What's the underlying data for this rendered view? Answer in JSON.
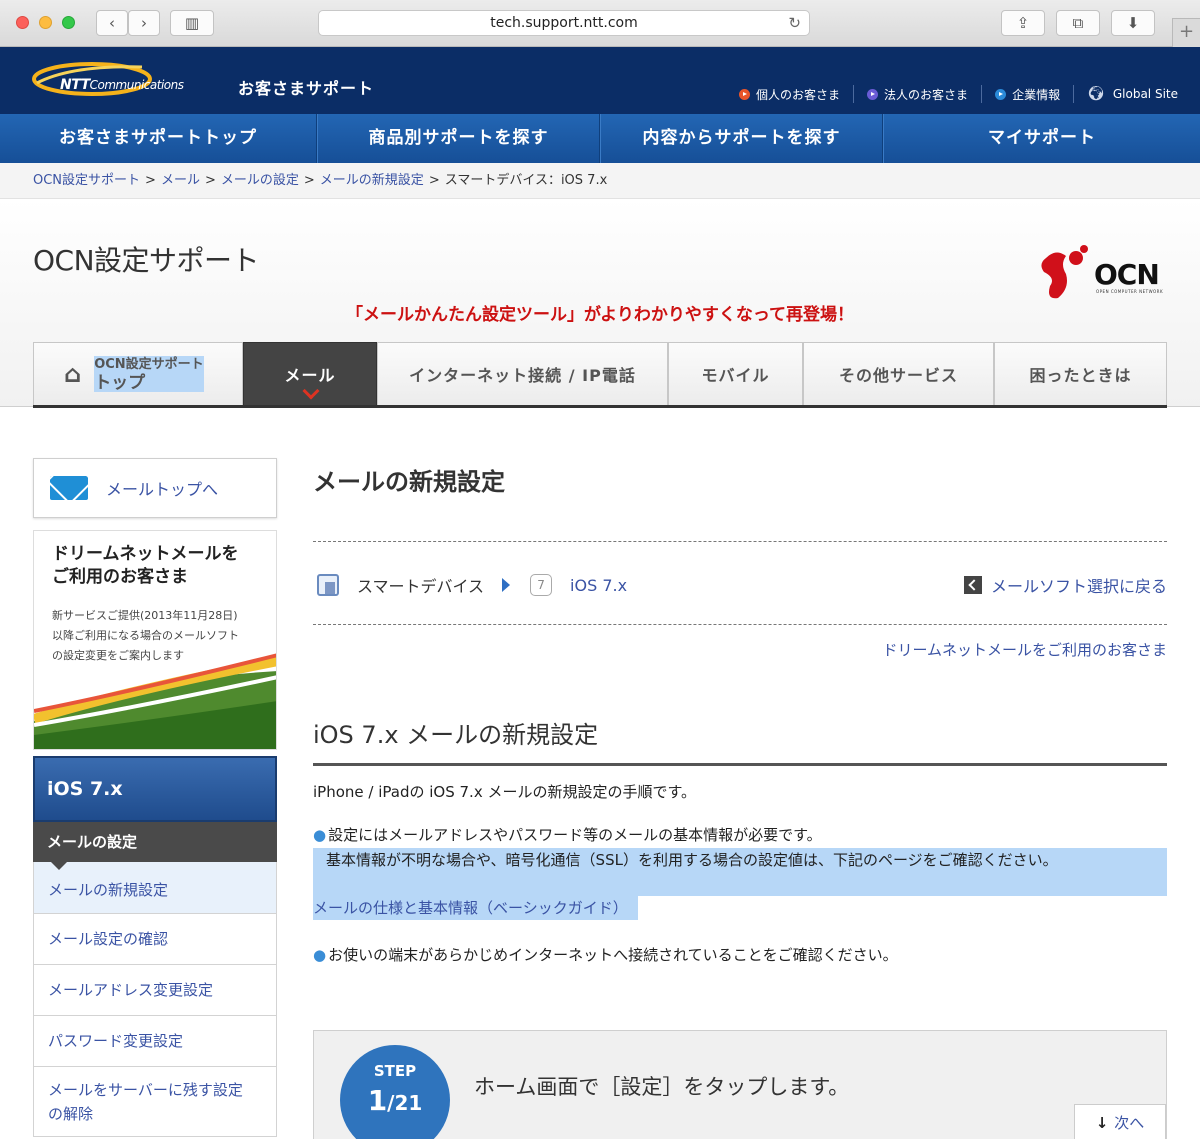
{
  "browser": {
    "url": "tech.support.ntt.com",
    "back_icon": "chevron-left-icon",
    "forward_icon": "chevron-right-icon"
  },
  "header": {
    "logo_brand": "NTT",
    "logo_sub": "Communications",
    "title": "お客さまサポート",
    "toplinks": [
      "個人のお客さま",
      "法人のお客さま",
      "企業情報",
      "Global Site"
    ]
  },
  "gnav": [
    "お客さまサポートトップ",
    "商品別サポートを探す",
    "内容からサポートを探す",
    "マイサポート"
  ],
  "breadcrumb": {
    "items": [
      "OCN設定サポート",
      "メール",
      "メールの設定",
      "メールの新規設定"
    ],
    "current": "スマートデバイス：iOS 7.x",
    "sep": ">"
  },
  "site_title": "OCN設定サポート",
  "ocn_logo": {
    "word": "OCN",
    "sub": "OPEN COMPUTER NETWORK"
  },
  "promo": "「メールかんたん設定ツール」がよりわかりやすくなって再登場！",
  "category_tabs": {
    "home_small": "OCN設定サポート",
    "home_big": "トップ",
    "tabs": [
      "メール",
      "インターネット接続 / IP電話",
      "モバイル",
      "その他サービス",
      "困ったときは"
    ]
  },
  "sidebar": {
    "mail_top": "メールトップへ",
    "banner_title_1": "ドリームネットメールを",
    "banner_title_2": "ご利用のお客さま",
    "banner_sub_1": "新サービスご提供(2013年11月28日)",
    "banner_sub_2": "以降ご利用になる場合のメールソフト",
    "banner_sub_3": "の設定変更をご案内します",
    "ios_heading": "iOS 7.x",
    "settings_heading": "メールの設定",
    "items": [
      "メールの新規設定",
      "メール設定の確認",
      "メールアドレス変更設定",
      "パスワード変更設定"
    ],
    "last_item_1": "メールをサーバーに残す設定",
    "last_item_2": "の解除"
  },
  "main": {
    "heading": "メールの新規設定",
    "device_label": "スマートデバイス",
    "os_label": "iOS 7.x",
    "back_link": "メールソフト選択に戻る",
    "dream_link": "ドリームネットメールをご利用のお客さま",
    "section_title": "iOS 7.x メールの新規設定",
    "intro": "iPhone / iPadの iOS 7.x メールの新規設定の手順です。",
    "bullet1_line1": "設定にはメールアドレスやパスワード等のメールの基本情報が必要です。",
    "bullet1_line2": "基本情報が不明な場合や、暗号化通信（SSL）を利用する場合の設定値は、下記のページをご確認ください。",
    "guide_link": "メールの仕様と基本情報（ベーシックガイド）",
    "bullet2": "お使いの端末があらかじめインターネットへ接続されていることをご確認ください。",
    "step_label": "STEP",
    "step_num": "1",
    "step_total": "/21",
    "step_text": "ホーム画面で［設定］をタップします。",
    "next": "次へ"
  }
}
